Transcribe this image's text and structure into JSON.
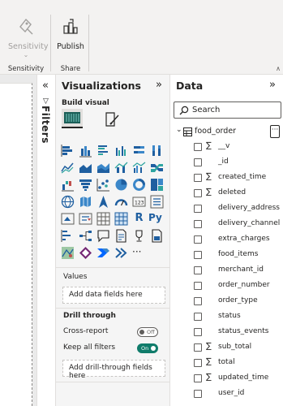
{
  "ribbon": {
    "sensitivity_label": "Sensitivity",
    "sensitivity_group": "Sensitivity",
    "publish_label": "Publish",
    "share_group": "Share"
  },
  "filters": {
    "label": "Filters"
  },
  "visualizations": {
    "title": "Visualizations",
    "build_visual": "Build visual",
    "values_label": "Values",
    "values_placeholder": "Add data fields here",
    "drill_through_label": "Drill through",
    "cross_report_label": "Cross-report",
    "cross_report_state": "Off",
    "keep_filters_label": "Keep all filters",
    "keep_filters_state": "On",
    "drill_placeholder": "Add drill-through fields here",
    "more_label": "···"
  },
  "data_pane": {
    "title": "Data",
    "search_placeholder": "Search",
    "table_name": "food_order",
    "more_label": "···",
    "fields": [
      {
        "name": "__v",
        "sigma": "∑"
      },
      {
        "name": "_id",
        "sigma": ""
      },
      {
        "name": "created_time",
        "sigma": "∑"
      },
      {
        "name": "deleted",
        "sigma": "∑"
      },
      {
        "name": "delivery_address",
        "sigma": ""
      },
      {
        "name": "delivery_channel",
        "sigma": ""
      },
      {
        "name": "extra_charges",
        "sigma": ""
      },
      {
        "name": "food_items",
        "sigma": ""
      },
      {
        "name": "merchant_id",
        "sigma": ""
      },
      {
        "name": "order_number",
        "sigma": ""
      },
      {
        "name": "order_type",
        "sigma": ""
      },
      {
        "name": "status",
        "sigma": ""
      },
      {
        "name": "status_events",
        "sigma": ""
      },
      {
        "name": "sub_total",
        "sigma": "∑"
      },
      {
        "name": "total",
        "sigma": "∑"
      },
      {
        "name": "updated_time",
        "sigma": "∑"
      },
      {
        "name": "user_id",
        "sigma": ""
      }
    ]
  }
}
